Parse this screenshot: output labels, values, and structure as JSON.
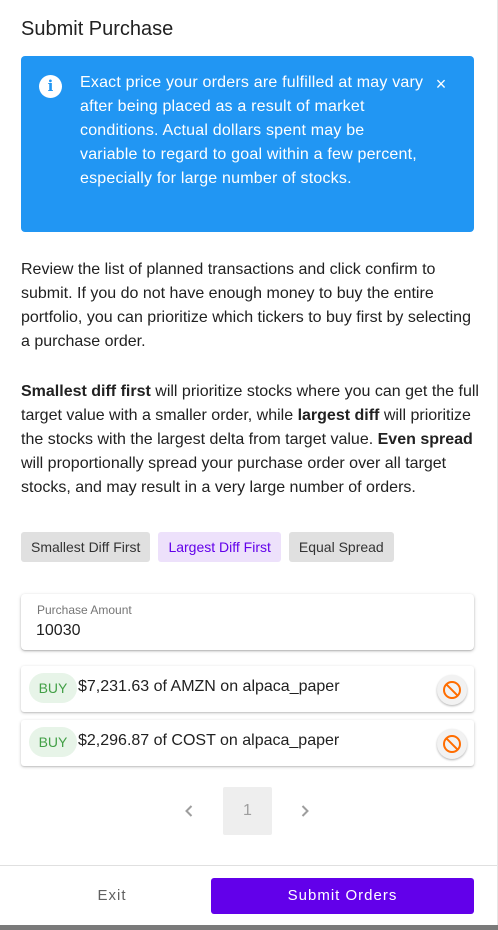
{
  "dialog": {
    "title": "Submit Purchase"
  },
  "alert": {
    "icon": "info-icon",
    "message": "Exact price your orders are fulfilled at may vary after being placed as a result of market conditions. Actual dollars spent may be variable to regard to goal within a few percent, especially for large number of stocks.",
    "close_icon": "close-icon",
    "close_glyph": "×",
    "color": "#2196f3"
  },
  "intro": {
    "text": "Review the list of planned transactions and click confirm to submit. If you do not have enough money to buy the entire portfolio, you can prioritize which tickers to buy first by selecting a purchase order."
  },
  "explanation": {
    "smallest_bold": "Smallest diff first",
    "part1": " will prioritize stocks where you can get the full target value with a smaller order, while ",
    "largest_bold": "largest diff",
    "part2": " will prioritize the stocks with the largest delta from target value. ",
    "even_bold": "Even spread",
    "part3": " will proportionally spread your purchase order over all target stocks, and may result in a very large number of orders."
  },
  "purchase_order_options": [
    {
      "label": "Smallest Diff First",
      "selected": false
    },
    {
      "label": "Largest Diff First",
      "selected": true
    },
    {
      "label": "Equal Spread",
      "selected": false
    }
  ],
  "amount": {
    "label": "Purchase Amount",
    "value": "10030"
  },
  "orders": [
    {
      "action": "BUY",
      "description": "$7,231.63 of AMZN on alpaca_paper",
      "remove_icon": "block-icon"
    },
    {
      "action": "BUY",
      "description": "$2,296.87 of COST on alpaca_paper",
      "remove_icon": "block-icon"
    }
  ],
  "pagination": {
    "current_page": "1",
    "prev_icon": "chevron-left-icon",
    "next_icon": "chevron-right-icon"
  },
  "footer": {
    "exit_label": "Exit",
    "submit_label": "Submit Orders"
  },
  "colors": {
    "accent": "#6200ea",
    "buy_text": "#43a047",
    "buy_background": "#e7f4e8",
    "cancel_icon": "#ff6d00"
  }
}
